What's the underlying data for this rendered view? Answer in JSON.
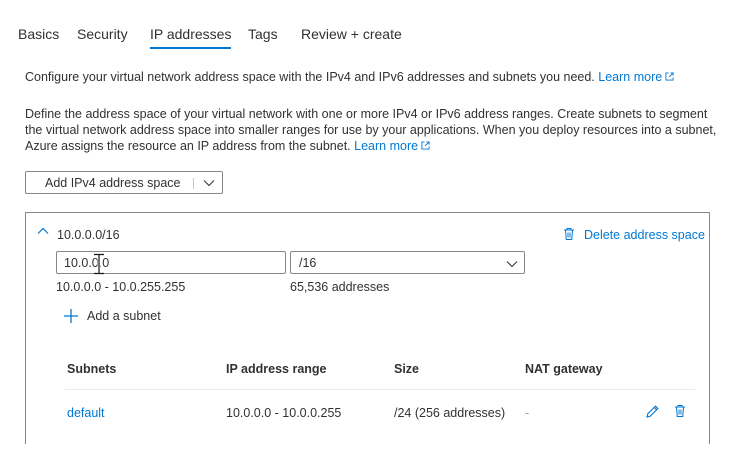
{
  "tabs": [
    {
      "label": "Basics",
      "active": false
    },
    {
      "label": "Security",
      "active": false
    },
    {
      "label": "IP addresses",
      "active": true
    },
    {
      "label": "Tags",
      "active": false
    },
    {
      "label": "Review + create",
      "active": false
    }
  ],
  "intro": {
    "text": "Configure your virtual network address space with the IPv4 and IPv6 addresses and subnets you need.",
    "link": "Learn more"
  },
  "description": {
    "text": "Define the address space of your virtual network with one or more IPv4 or IPv6 address ranges. Create subnets to segment the virtual network address space into smaller ranges for use by your applications. When you deploy resources into a subnet, Azure assigns the resource an IP address from the subnet.",
    "link": "Learn more"
  },
  "add_space_button": "Add IPv4 address space",
  "address_space": {
    "title": "10.0.0.0/16",
    "delete_label": "Delete address space",
    "address_value": "10.0.0.0",
    "prefix_value": "/16",
    "range": "10.0.0.0 - 10.0.255.255",
    "count": "65,536 addresses",
    "add_subnet_label": "Add a subnet"
  },
  "subnet_table": {
    "headers": [
      "Subnets",
      "IP address range",
      "Size",
      "NAT gateway"
    ],
    "rows": [
      {
        "name": "default",
        "range": "10.0.0.0 - 10.0.0.255",
        "size": "/24 (256 addresses)",
        "nat": "-"
      }
    ]
  },
  "colors": {
    "accent": "#0078d4",
    "text": "#323130",
    "border": "#8a8886"
  }
}
